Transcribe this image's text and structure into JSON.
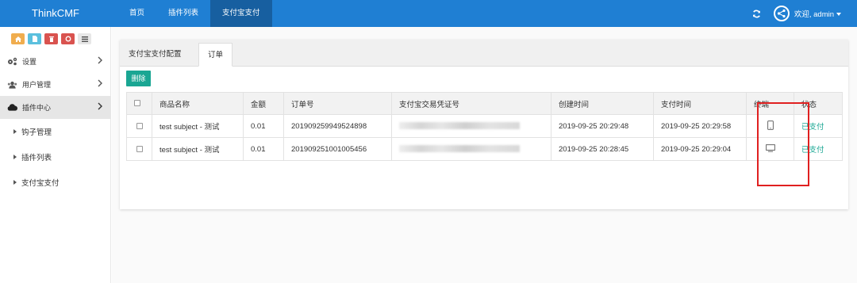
{
  "brand": "ThinkCMF",
  "topnav": [
    "首页",
    "插件列表",
    "支付宝支付"
  ],
  "user": {
    "greeting": "欢迎, admin"
  },
  "sidebar": {
    "menu": [
      {
        "label": "设置",
        "icon": "gears-icon"
      },
      {
        "label": "用户管理",
        "icon": "users-icon"
      },
      {
        "label": "插件中心",
        "icon": "cloud-icon"
      }
    ],
    "submenu": [
      "钩子管理",
      "插件列表",
      "支付宝支付"
    ]
  },
  "tabs": [
    "支付宝支付配置",
    "订单"
  ],
  "toolbar": {
    "delete_label": "删除"
  },
  "table": {
    "headers": [
      "商品名称",
      "金额",
      "订单号",
      "支付宝交易凭证号",
      "创建时间",
      "支付时间",
      "终端",
      "状态"
    ],
    "rows": [
      {
        "name": "test subject - 测试",
        "amount": "0.01",
        "order_no": "201909259949524898",
        "created": "2019-09-25 20:29:48",
        "paid_at": "2019-09-25 20:29:58",
        "terminal": "mobile-icon",
        "status": "已支付"
      },
      {
        "name": "test subject - 测试",
        "amount": "0.01",
        "order_no": "201909251001005456",
        "created": "2019-09-25 20:28:45",
        "paid_at": "2019-09-25 20:29:04",
        "terminal": "desktop-icon",
        "status": "已支付"
      }
    ]
  },
  "colors": {
    "topbar": "#1f7fd3",
    "accent": "#1aa693",
    "highlight": "#e02020"
  }
}
